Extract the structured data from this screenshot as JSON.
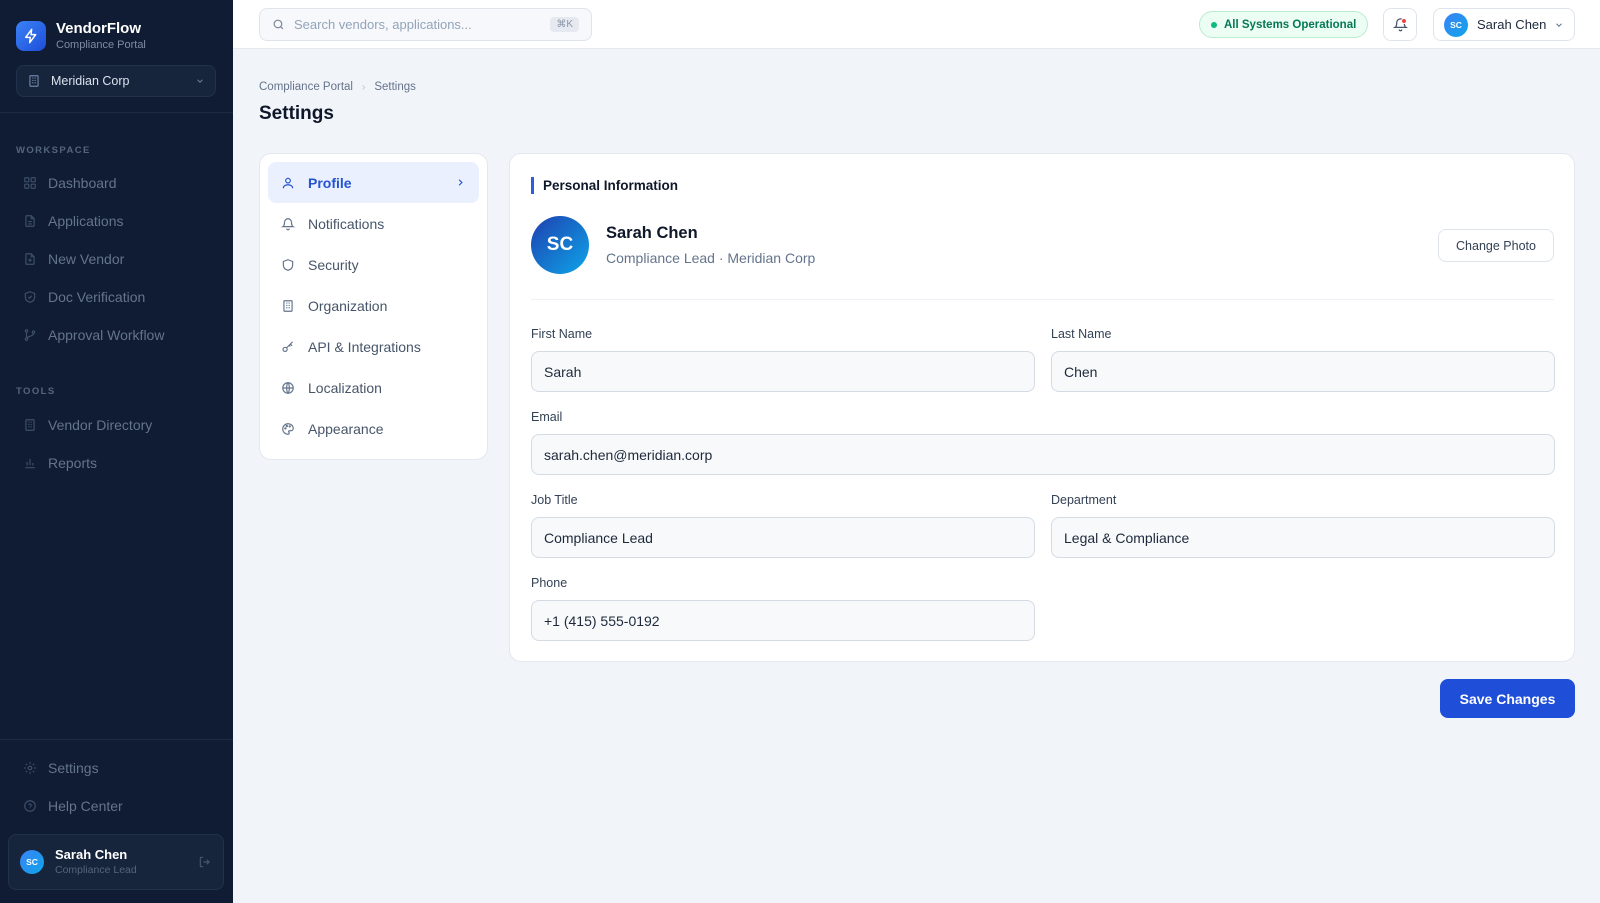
{
  "brand": {
    "name": "VendorFlow",
    "subtitle": "Compliance Portal"
  },
  "org_selector": {
    "value": "Meridian Corp"
  },
  "sidebar": {
    "sections": [
      {
        "label": "WORKSPACE",
        "items": [
          "Dashboard",
          "Applications",
          "New Vendor",
          "Doc Verification",
          "Approval Workflow"
        ]
      },
      {
        "label": "TOOLS",
        "items": [
          "Vendor Directory",
          "Reports"
        ]
      }
    ],
    "bottom_items": [
      "Settings",
      "Help Center"
    ],
    "user": {
      "initials": "SC",
      "name": "Sarah Chen",
      "role": "Compliance Lead"
    }
  },
  "topbar": {
    "search_placeholder": "Search vendors, applications...",
    "search_shortcut": "⌘K",
    "status": "All Systems Operational",
    "user": {
      "initials": "SC",
      "name": "Sarah Chen"
    }
  },
  "breadcrumb": [
    "Compliance Portal",
    "Settings"
  ],
  "page_title": "Settings",
  "settings_nav": [
    {
      "label": "Profile",
      "icon": "user-icon",
      "active": true
    },
    {
      "label": "Notifications",
      "icon": "bell-icon"
    },
    {
      "label": "Security",
      "icon": "shield-icon"
    },
    {
      "label": "Organization",
      "icon": "building-icon"
    },
    {
      "label": "API & Integrations",
      "icon": "key-icon"
    },
    {
      "label": "Localization",
      "icon": "globe-icon"
    },
    {
      "label": "Appearance",
      "icon": "palette-icon"
    }
  ],
  "panel": {
    "title": "Personal Information",
    "profile": {
      "initials": "SC",
      "name": "Sarah Chen",
      "subtitle": "Compliance Lead · Meridian Corp"
    },
    "change_photo": "Change Photo",
    "fields": {
      "first_name": {
        "label": "First Name",
        "value": "Sarah"
      },
      "last_name": {
        "label": "Last Name",
        "value": "Chen"
      },
      "email": {
        "label": "Email",
        "value": "sarah.chen@meridian.corp"
      },
      "job_title": {
        "label": "Job Title",
        "value": "Compliance Lead"
      },
      "department": {
        "label": "Department",
        "value": "Legal & Compliance"
      },
      "phone": {
        "label": "Phone",
        "value": "+1 (415) 555-0192"
      }
    }
  },
  "save_button": "Save Changes",
  "colors": {
    "accent": "#1f4fd8",
    "sidebar_bg": "#0f1c33",
    "status_green": "#10b981",
    "alert_red": "#ef4444"
  }
}
